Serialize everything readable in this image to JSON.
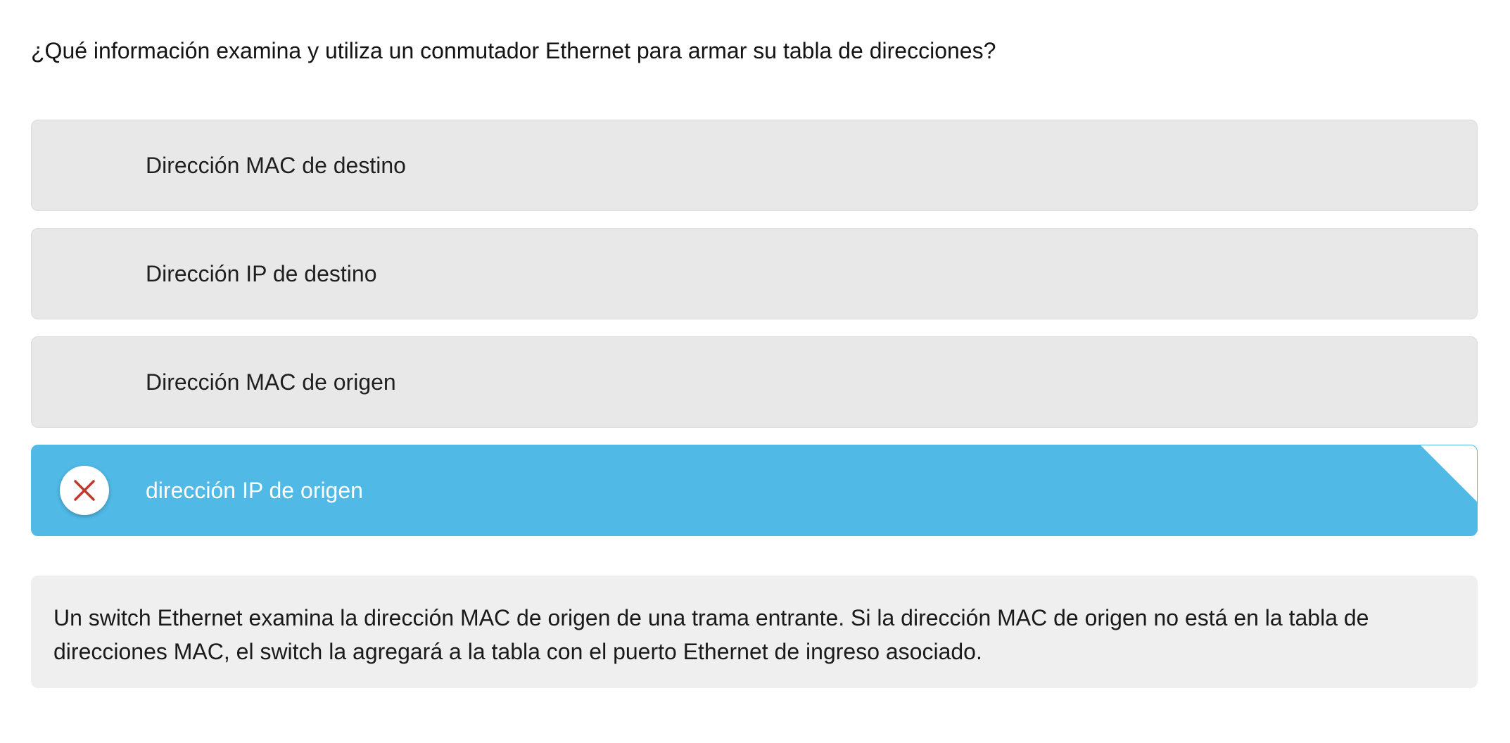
{
  "question": {
    "text": "¿Qué información examina y utiliza un conmutador Ethernet para armar su tabla de direcciones?"
  },
  "options": [
    {
      "label": "Dirección MAC de destino",
      "selected": false
    },
    {
      "label": "Dirección IP de destino",
      "selected": false
    },
    {
      "label": "Dirección MAC de origen",
      "selected": false
    },
    {
      "label": "dirección IP de origen",
      "selected": true,
      "result_icon": "x-mark-icon"
    }
  ],
  "feedback": {
    "text": "Un switch Ethernet examina la dirección MAC de origen de una trama entrante. Si la dirección MAC de origen no está en la tabla de direcciones MAC, el switch la agregará a la tabla con el puerto Ethernet de ingreso asociado."
  },
  "colors": {
    "selected_option_bg": "#50b9e6",
    "option_bg": "#e8e8e8",
    "incorrect_mark": "#c0392b",
    "feedback_bg": "#efefef"
  }
}
